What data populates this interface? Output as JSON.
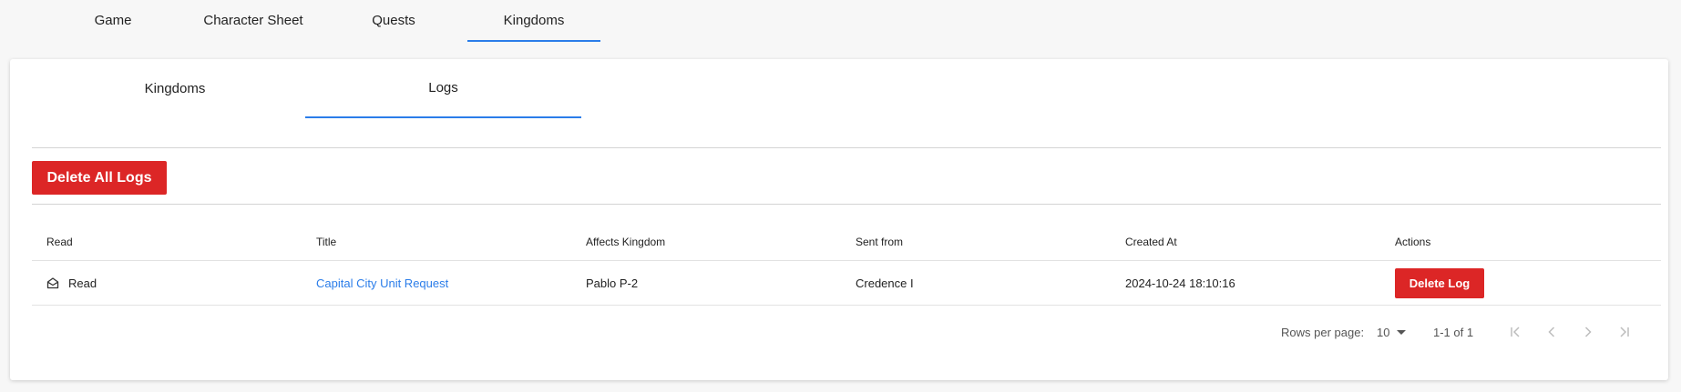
{
  "top_tabs": [
    {
      "label": "Game",
      "active": false
    },
    {
      "label": "Character Sheet",
      "active": false
    },
    {
      "label": "Quests",
      "active": false
    },
    {
      "label": "Kingdoms",
      "active": true
    }
  ],
  "inner_tabs": [
    {
      "label": "Kingdoms",
      "active": false
    },
    {
      "label": "Logs",
      "active": true
    }
  ],
  "delete_all_label": "Delete All Logs",
  "table": {
    "columns": [
      "Read",
      "Title",
      "Affects Kingdom",
      "Sent from",
      "Created At",
      "Actions"
    ],
    "rows": [
      {
        "read": "Read",
        "read_icon": "envelope-open-icon",
        "title": "Capital City Unit Request",
        "affects_kingdom": "Pablo P-2",
        "sent_from": "Credence I",
        "created_at": "2024-10-24 18:10:16",
        "action_label": "Delete Log"
      }
    ]
  },
  "pagination": {
    "rows_per_page_label": "Rows per page:",
    "rows_per_page_value": "10",
    "range_text": "1-1 of 1",
    "icons": [
      "first-page-icon",
      "previous-page-icon",
      "next-page-icon",
      "last-page-icon"
    ]
  },
  "colors": {
    "accent": "#2b7de9",
    "danger": "#dc2626"
  }
}
